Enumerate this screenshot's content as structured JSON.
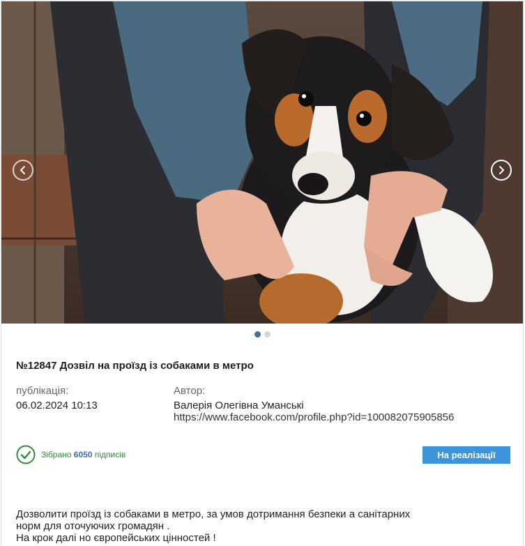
{
  "petition": {
    "title": "№12847 Дозвіл на проїзд із собаками в метро",
    "publication_label": "публікація:",
    "publication_date": "06.02.2024 10:13",
    "author_label": "Автор:",
    "author_name": "Валерія Олегівна Уманські",
    "author_link": "https://www.facebook.com/profile.php?id=100082075905856",
    "collected_prefix": "Зібрано",
    "signatures_count": "6050",
    "collected_suffix": "підписів",
    "status_label": "На реалізації",
    "description_line1": "Дозволити проїзд із собаками в метро, за умов дотримання безпеки а санітарних",
    "description_line2": "норм для оточуючих громадян .",
    "description_line3": "На крок далі но європейських цінностей !"
  },
  "carousel": {
    "slide_count": 2,
    "active_slide": 1,
    "prev_icon": "chevron-left-icon",
    "next_icon": "chevron-right-icon"
  },
  "colors": {
    "accent_blue": "#3c94dc",
    "active_dot": "#3f6fae",
    "success_green": "#2e8b3a"
  }
}
